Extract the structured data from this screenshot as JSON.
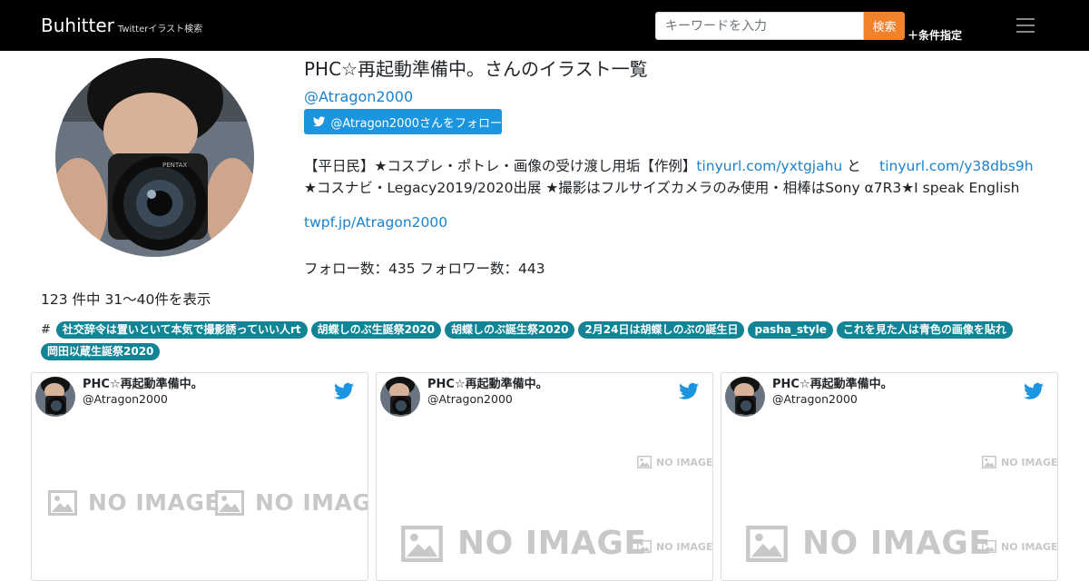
{
  "navbar": {
    "brand": "Buhitter",
    "brand_sub": "Twitterイラスト検索",
    "search_placeholder": "キーワードを入力",
    "search_button": "検索",
    "advanced_link": "＋条件指定"
  },
  "profile": {
    "title": "PHC☆再起動準備中。さんのイラスト一覧",
    "handle": "@Atragon2000",
    "follow_button": "@Atragon2000さんをフォロー",
    "bio_part1": "【平日民】★コスプレ・ポトレ・画像の受け渡し用垢【作例】",
    "bio_link1": "tinyurl.com/yxtgjahu",
    "bio_part2": " と　 ",
    "bio_link2": "tinyurl.com/y38dbs9h",
    "bio_part3": " ★コスナビ・Legacy2019/2020出展 ★撮影はフルサイズカメラのみ使用・相棒はSony α7R3★I speak English",
    "web_link": "twpf.jp/Atragon2000",
    "counts": "フォロー数：435 フォロワー数：443"
  },
  "results": {
    "summary": "123 件中 31〜40件を表示"
  },
  "tags": {
    "hash": "#",
    "items": [
      "社交辞令は置いといて本気で撮影誘っていい人rt",
      "胡蝶しのぶ生誕祭2020",
      "胡蝶しのぶ誕生祭2020",
      "2月24日は胡蝶しのぶの誕生日",
      "pasha_style",
      "これを見た人は青色の画像を貼れ",
      "岡田以蔵生誕祭2020"
    ]
  },
  "placeholder_label": "NO IMAGE",
  "cards": [
    {
      "name": "PHC☆再起動準備中。",
      "handle": "@Atragon2000"
    },
    {
      "name": "PHC☆再起動準備中。",
      "handle": "@Atragon2000"
    },
    {
      "name": "PHC☆再起動準備中。",
      "handle": "@Atragon2000"
    }
  ],
  "colors": {
    "navbar_bg": "#000000",
    "search_button": "#f0822c",
    "twitter_blue": "#1b95e0",
    "link": "#1a82d0",
    "tag_bg": "#138496"
  }
}
